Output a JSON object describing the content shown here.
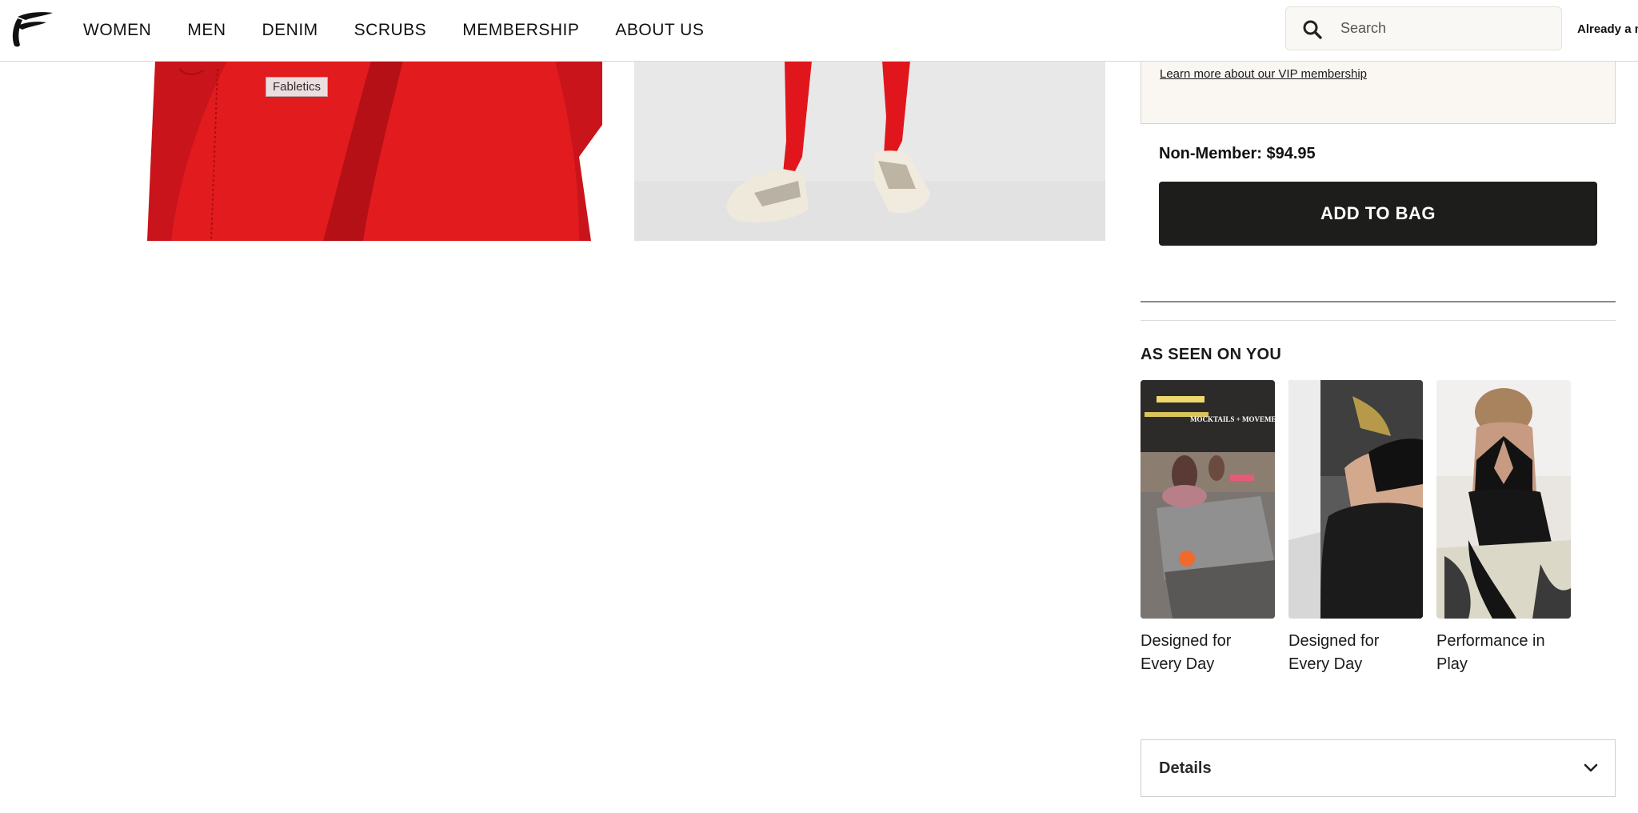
{
  "header": {
    "nav": [
      "WOMEN",
      "MEN",
      "DENIM",
      "SCRUBS",
      "MEMBERSHIP",
      "ABOUT US"
    ],
    "search_placeholder": "Search",
    "member_link": "Already a m"
  },
  "gallery": {
    "tag_label": "Fabletics"
  },
  "purchase": {
    "vip_link": "Learn more about our VIP membership",
    "nonmember_label": "Non-Member:",
    "nonmember_price": "$94.95",
    "add_to_bag": "ADD TO BAG"
  },
  "as_seen": {
    "title": "AS SEEN ON YOU",
    "items": [
      {
        "caption": "Designed for Every Day",
        "overlay_text": "MOCKTAILS + MOVEMENT"
      },
      {
        "caption": "Designed for Every Day"
      },
      {
        "caption": "Performance in Play"
      }
    ]
  },
  "details": {
    "label": "Details"
  },
  "colors": {
    "legging_red": "#e21b1f",
    "button_dark": "#1d1d1b",
    "vip_bg": "#faf7f3"
  }
}
